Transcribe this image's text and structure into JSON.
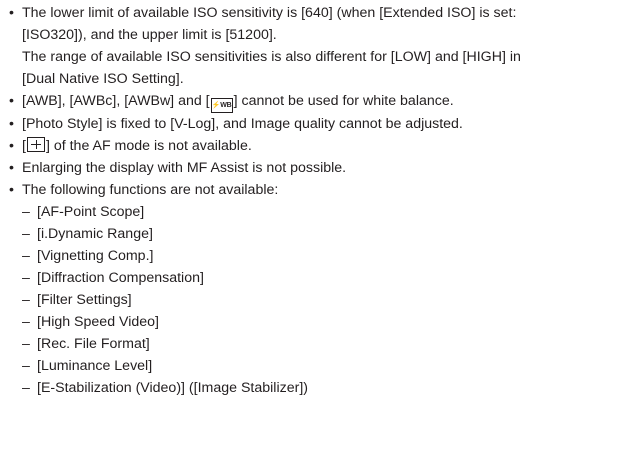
{
  "iso_bullet": {
    "lines": [
      "The lower limit of available ISO sensitivity is [640] (when [Extended ISO] is set:",
      "[ISO320]), and the upper limit is [51200].",
      "The range of available ISO sensitivities is also different for [LOW] and [HIGH] in",
      "[Dual Native ISO Setting]."
    ]
  },
  "wb_bullet": {
    "before_icon": "[AWB], [AWBc], [AWBw] and [",
    "icon_name": "flash-wb-icon",
    "icon_text": "⚡WB",
    "after_icon": "] cannot be used for white balance."
  },
  "photo_style_bullet": "[Photo Style] is fixed to [V-Log], and Image quality cannot be adjusted.",
  "af_bullet": {
    "before_icon": "[",
    "icon_name": "af-plus-icon",
    "after_icon": "] of the AF mode is not available."
  },
  "mf_bullet": "Enlarging the display with MF Assist is not possible.",
  "functions_bullet": {
    "intro": "The following functions are not available:",
    "items": [
      "[AF-Point Scope]",
      "[i.Dynamic Range]",
      "[Vignetting Comp.]",
      "[Diffraction Compensation]",
      "[Filter Settings]",
      "[High Speed Video]",
      "[Rec. File Format]",
      "[Luminance Level]",
      "[E-Stabilization (Video)] ([Image Stabilizer])"
    ]
  },
  "bullet_glyph": "•",
  "dash_glyph": "–"
}
